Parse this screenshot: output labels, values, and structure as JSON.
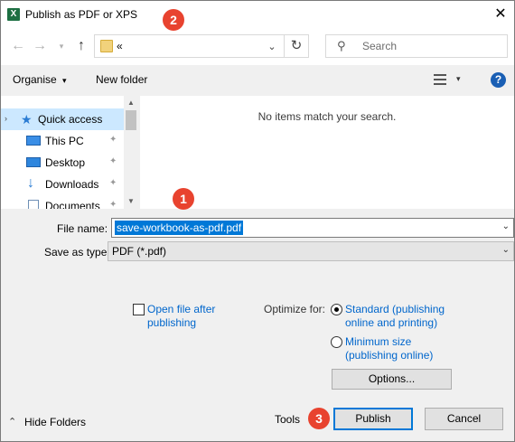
{
  "window": {
    "title": "Publish as PDF or XPS",
    "app_icon": "excel-icon",
    "close": "✕"
  },
  "nav": {
    "back": "←",
    "forward": "→",
    "recent": "▾",
    "up": "↑",
    "address_text": "«",
    "address_chevron": "⌄",
    "refresh": "↻",
    "search_icon": "⚲",
    "search_placeholder": "Search"
  },
  "toolbar": {
    "organise_label": "Organise",
    "organise_chevron": "▾",
    "new_folder_label": "New folder",
    "view_chevron": "▾",
    "help": "?"
  },
  "sidebar": {
    "items": [
      {
        "label": "Quick access",
        "icon": "star-icon",
        "selected": true
      },
      {
        "label": "This PC",
        "icon": "computer-icon",
        "pinned": true
      },
      {
        "label": "Desktop",
        "icon": "desktop-icon",
        "pinned": true
      },
      {
        "label": "Downloads",
        "icon": "download-icon",
        "pinned": true
      },
      {
        "label": "Documents",
        "icon": "documents-icon",
        "pinned": true
      }
    ],
    "pin_glyph": "📌",
    "expand_glyph": "›"
  },
  "content": {
    "empty_message": "No items match your search."
  },
  "form": {
    "filename_label": "File name:",
    "filename_value": "save-workbook-as-pdf.pdf",
    "savetype_label": "Save as type:",
    "savetype_value": "PDF (*.pdf)",
    "chevron": "⌄"
  },
  "options": {
    "open_after_line1": "Open file after",
    "open_after_line2": "publishing",
    "open_after_checked": false,
    "optimize_label": "Optimize for:",
    "standard_line1": "Standard (publishing",
    "standard_line2": "online and printing)",
    "minimum_line1": "Minimum size",
    "minimum_line2": "(publishing online)",
    "selected": "standard",
    "options_button": "Options..."
  },
  "footer": {
    "hide_folders_glyph": "⌃",
    "hide_folders_label": "Hide Folders",
    "tools_label": "Tools",
    "publish_label": "Publish",
    "cancel_label": "Cancel"
  },
  "markers": [
    "1",
    "2",
    "3"
  ],
  "colors": {
    "accent": "#0078d7",
    "marker": "#e8432f",
    "link": "#0066cc",
    "selection": "#cce8ff"
  }
}
